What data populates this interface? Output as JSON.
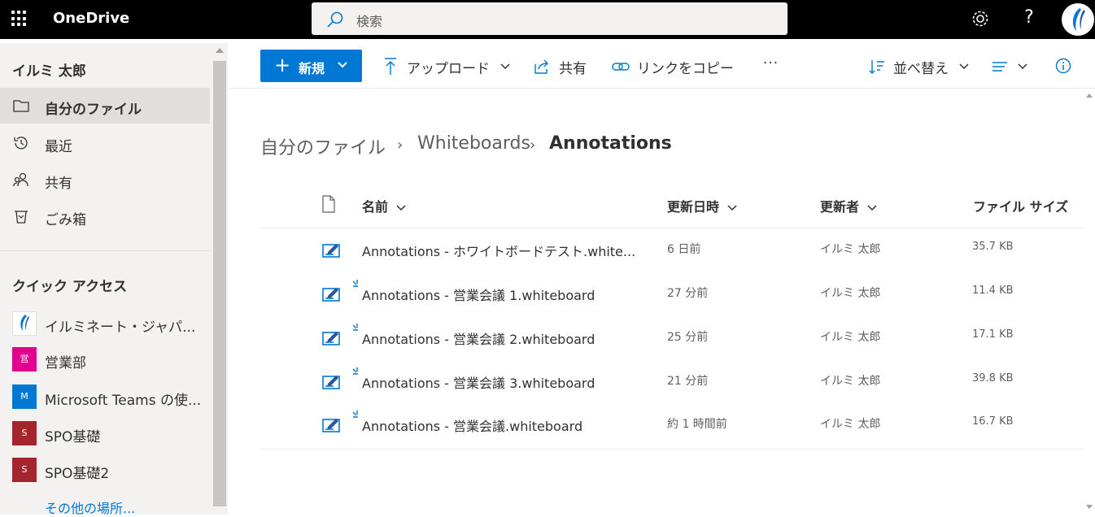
{
  "app": {
    "name": "OneDrive"
  },
  "search": {
    "placeholder": "検索"
  },
  "user": {
    "name": "イルミ 太郎"
  },
  "nav": {
    "items": [
      {
        "label": "自分のファイル",
        "icon": "folder-icon",
        "selected": true
      },
      {
        "label": "最近",
        "icon": "history-icon",
        "selected": false
      },
      {
        "label": "共有",
        "icon": "people-icon",
        "selected": false
      },
      {
        "label": "ごみ箱",
        "icon": "recycle-bin-icon",
        "selected": false
      }
    ]
  },
  "quick_access": {
    "title": "クイック アクセス",
    "items": [
      {
        "label": "イルミネート・ジャパ...",
        "badge": "",
        "color": "#ffffff"
      },
      {
        "label": "営業部",
        "badge": "営",
        "color": "#e3008c"
      },
      {
        "label": "Microsoft Teams の使...",
        "badge": "M",
        "color": "#0078d4"
      },
      {
        "label": "SPO基礎",
        "badge": "S",
        "color": "#a4262c"
      },
      {
        "label": "SPO基礎2",
        "badge": "S",
        "color": "#a4262c"
      }
    ],
    "more": "その他の場所..."
  },
  "toolbar": {
    "new_label": "新規",
    "upload_label": "アップロード",
    "share_label": "共有",
    "copy_link_label": "リンクをコピー",
    "more_label": "···",
    "sort_label": "並べ替え"
  },
  "breadcrumb": [
    "自分のファイル",
    "Whiteboards",
    "Annotations"
  ],
  "columns": {
    "name": "名前",
    "modified": "更新日時",
    "modified_by": "更新者",
    "size": "ファイル サイズ"
  },
  "files": [
    {
      "name": "Annotations - ホワイトボードテスト.white...",
      "modified": "6 日前",
      "modified_by": "イルミ 太郎",
      "size": "35.7 KB",
      "new": false
    },
    {
      "name": "Annotations - 営業会議 1.whiteboard",
      "modified": "27 分前",
      "modified_by": "イルミ 太郎",
      "size": "11.4 KB",
      "new": true
    },
    {
      "name": "Annotations - 営業会議 2.whiteboard",
      "modified": "25 分前",
      "modified_by": "イルミ 太郎",
      "size": "17.1 KB",
      "new": true
    },
    {
      "name": "Annotations - 営業会議 3.whiteboard",
      "modified": "21 分前",
      "modified_by": "イルミ 太郎",
      "size": "39.8 KB",
      "new": true
    },
    {
      "name": "Annotations - 営業会議.whiteboard",
      "modified": "約 1 時間前",
      "modified_by": "イルミ 太郎",
      "size": "16.7 KB",
      "new": true
    }
  ],
  "colors": {
    "accent": "#0078d4",
    "topbar": "#000000",
    "sidebar": "#f3f2f1"
  }
}
